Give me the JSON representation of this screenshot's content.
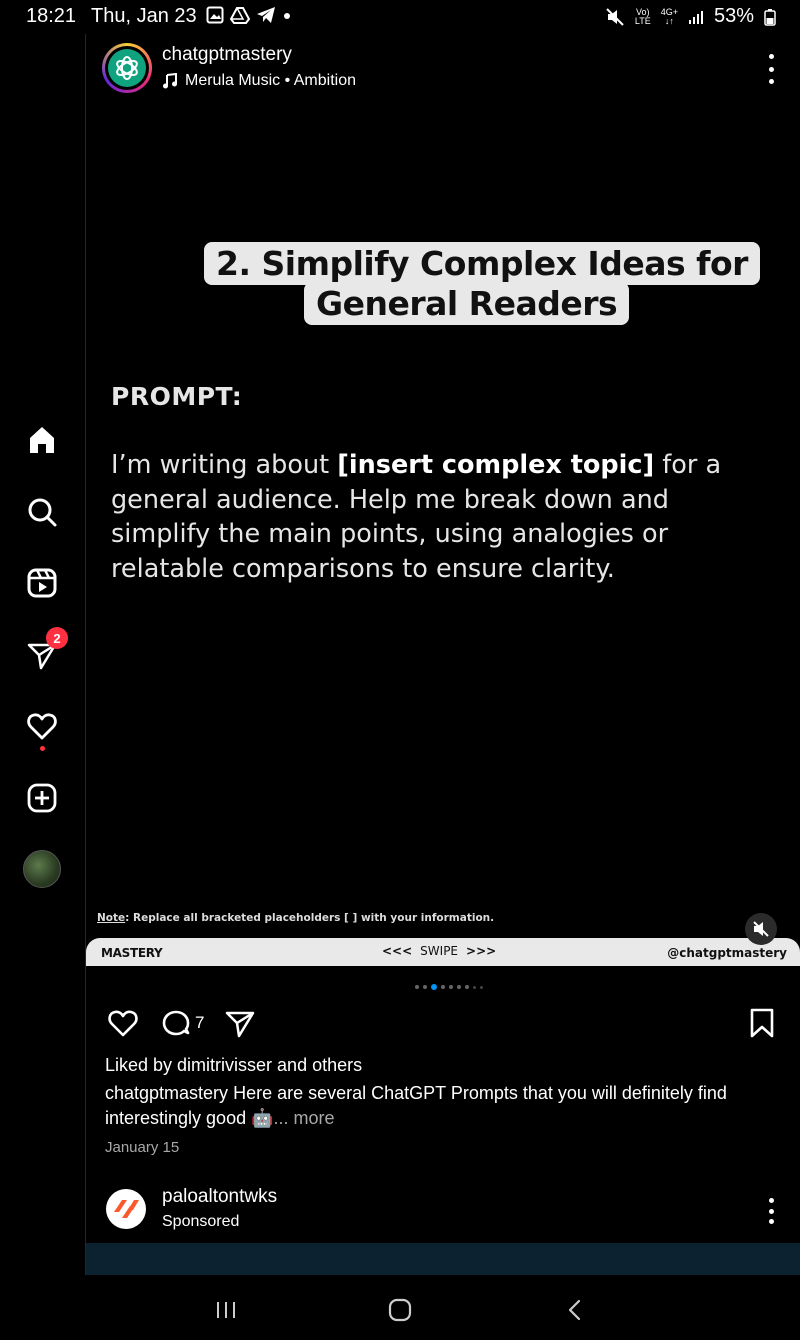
{
  "status_bar": {
    "time": "18:21",
    "date": "Thu, Jan 23",
    "net_top": "Vo)",
    "net_bottom": "LTE",
    "gen": "4G+",
    "battery": "53%"
  },
  "rail": {
    "items": [
      "home",
      "search",
      "reels",
      "direct-messages",
      "notifications",
      "create",
      "profile"
    ],
    "messages_badge": "2"
  },
  "post": {
    "username": "chatgptmastery",
    "music": "Merula Music • Ambition",
    "slide": {
      "title_line1": "2. Simplify Complex Ideas for",
      "title_line2": "General Readers",
      "prompt_label": "PROMPT:",
      "prompt_before": "I’m writing about ",
      "prompt_bold": "[insert complex topic]",
      "prompt_after": " for a general audience. Help me break down and simplify the main points, using analogies or relatable comparisons to ensure clarity.",
      "note_label": "Note",
      "note_text": ": Replace all bracketed placeholders [ ] with your information.",
      "footer_left": "MASTERY",
      "footer_swipe": "SWIPE",
      "footer_right": "@chatgptmastery"
    },
    "comment_count": "7",
    "likes": "Liked by dimitrivisser and others",
    "caption_user": "chatgptmastery",
    "caption_text": " Here are several ChatGPT Prompts that you will definitely find interestingly good 🤖",
    "caption_more": "... more",
    "date": "January 15"
  },
  "next_post": {
    "username": "paloaltontwks",
    "sponsored": "Sponsored"
  },
  "colors": {
    "accent_blue": "#0095f6",
    "badge_red": "#ff3040",
    "brand_orange": "#fa582d"
  }
}
